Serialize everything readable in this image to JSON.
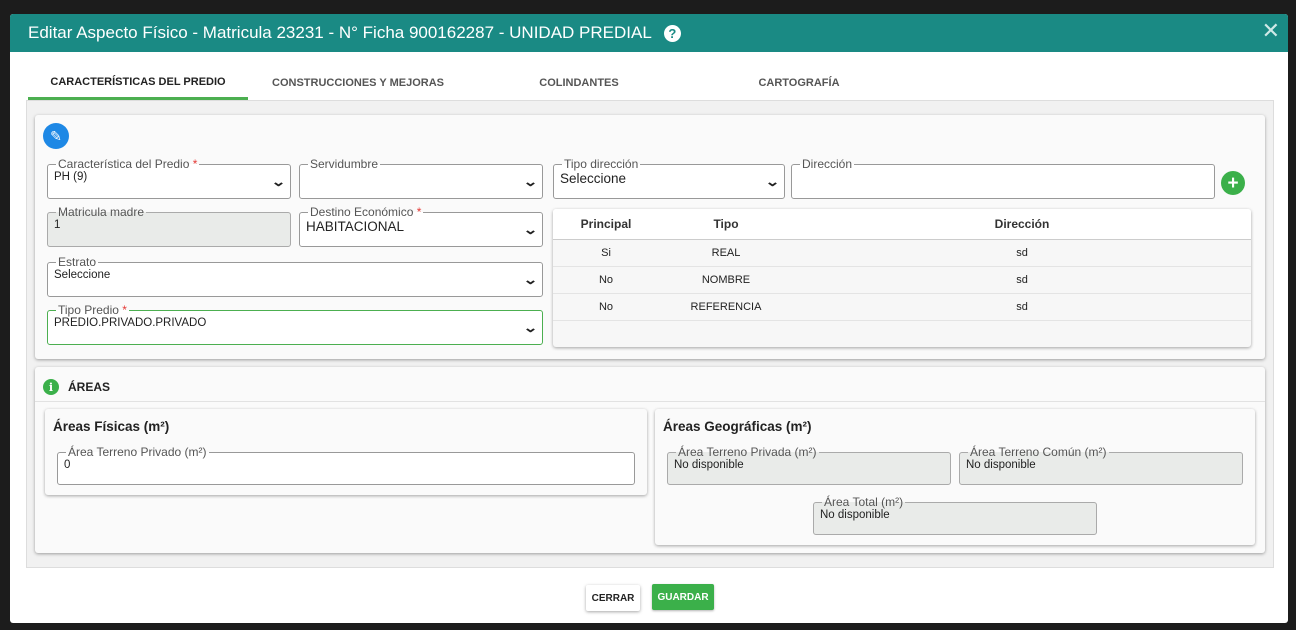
{
  "modal": {
    "title": "Editar Aspecto Físico - Matricula 23231 - N° Ficha 900162287 - UNIDAD PREDIAL",
    "help_icon": "?",
    "close_icon": "✕"
  },
  "tabs": [
    {
      "label": "CARACTERÍSTICAS DEL PREDIO",
      "active": true
    },
    {
      "label": "CONSTRUCCIONES Y MEJORAS",
      "active": false
    },
    {
      "label": "COLINDANTES",
      "active": false
    },
    {
      "label": "CARTOGRAFÍA",
      "active": false
    }
  ],
  "form": {
    "caracteristica": {
      "label": "Característica del Predio",
      "value": "PH (9)",
      "required": "*"
    },
    "servidumbre": {
      "label": "Servidumbre",
      "value": ""
    },
    "tipo_direccion": {
      "label": "Tipo dirección",
      "value": "Seleccione"
    },
    "direccion": {
      "label": "Dirección",
      "value": ""
    },
    "matricula_madre": {
      "label": "Matricula madre",
      "value": "1"
    },
    "destino": {
      "label": "Destino Económico",
      "value": "HABITACIONAL",
      "required": "*"
    },
    "estrato": {
      "label": "Estrato",
      "value": "Seleccione"
    },
    "tipo_predio": {
      "label": "Tipo Predio",
      "value": "PREDIO.PRIVADO.PRIVADO",
      "required": "*"
    }
  },
  "address_table": {
    "headers": [
      "Principal",
      "Tipo",
      "Dirección"
    ],
    "rows": [
      [
        "Si",
        "REAL",
        "sd"
      ],
      [
        "No",
        "NOMBRE",
        "sd"
      ],
      [
        "No",
        "REFERENCIA",
        "sd"
      ]
    ]
  },
  "areas": {
    "title": "ÁREAS",
    "fisicas": {
      "title": "Áreas Físicas (m²)",
      "terreno_privado": {
        "label": "Área Terreno Privado (m²)",
        "value": "0"
      }
    },
    "geograficas": {
      "title": "Áreas Geográficas (m²)",
      "terreno_privada": {
        "label": "Área Terreno Privada (m²)",
        "value": "No disponible"
      },
      "terreno_comun": {
        "label": "Área Terreno Común (m²)",
        "value": "No disponible"
      },
      "total": {
        "label": "Área Total (m²)",
        "value": "No disponible"
      }
    }
  },
  "footer": {
    "close_label": "CERRAR",
    "save_label": "GUARDAR"
  },
  "colors": {
    "header": "#1a8a84",
    "accent_green": "#4caf50",
    "edit_blue": "#1e88e5"
  }
}
